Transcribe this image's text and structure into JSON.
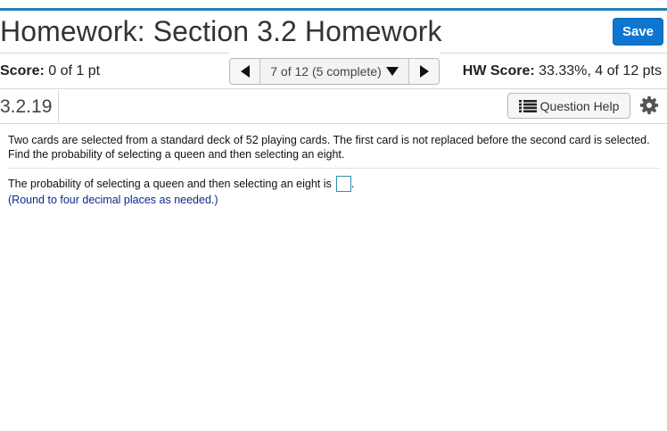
{
  "header": {
    "title": "Homework: Section 3.2 Homework",
    "save_label": "Save"
  },
  "score": {
    "label": "Score:",
    "value": "0 of 1 pt"
  },
  "navigator": {
    "position": "7 of 12 (5 complete)"
  },
  "hw_score": {
    "label": "HW Score:",
    "value": "33.33%, 4 of 12 pts"
  },
  "question": {
    "number": "3.2.19",
    "help_label": "Question Help",
    "text": "Two cards are selected from a standard deck of 52 playing cards. The first card is not replaced before the second card is selected. Find the probability of selecting a queen and then selecting an eight.",
    "answer_prompt": "The probability of selecting a queen and then selecting an eight is",
    "answer_value": "",
    "answer_suffix": ".",
    "hint": "(Round to four decimal places as needed.)"
  },
  "colors": {
    "accent": "#1f7fb8",
    "save_button": "#0e76d0",
    "hint_text": "#0b2a8a"
  },
  "icons": [
    "triangle-left-icon",
    "triangle-down-icon",
    "triangle-right-icon",
    "list-icon",
    "gear-icon"
  ]
}
